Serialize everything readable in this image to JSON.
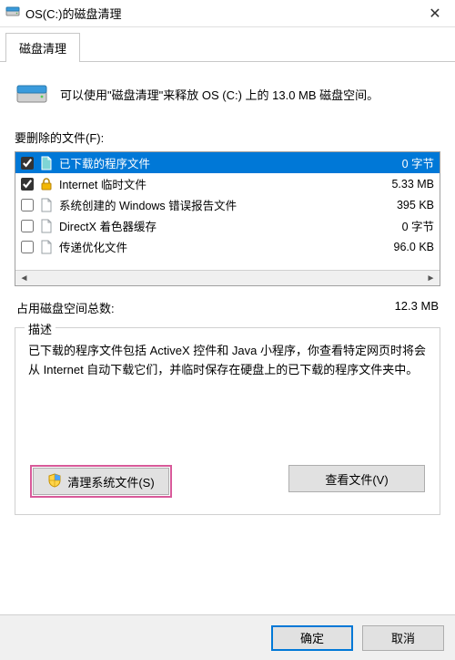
{
  "window": {
    "title": "OS(C:)的磁盘清理",
    "close_glyph": "✕"
  },
  "tab": {
    "label": "磁盘清理"
  },
  "intro": {
    "text": "可以使用\"磁盘清理\"来释放 OS (C:) 上的 13.0 MB 磁盘空间。"
  },
  "files_label": "要删除的文件(F):",
  "items": [
    {
      "checked": true,
      "selected": true,
      "icon": "file",
      "name": "已下载的程序文件",
      "size": "0 字节"
    },
    {
      "checked": true,
      "selected": false,
      "icon": "lock",
      "name": "Internet 临时文件",
      "size": "5.33 MB"
    },
    {
      "checked": false,
      "selected": false,
      "icon": "file",
      "name": "系统创建的 Windows 错误报告文件",
      "size": "395 KB"
    },
    {
      "checked": false,
      "selected": false,
      "icon": "file",
      "name": "DirectX 着色器缓存",
      "size": "0 字节"
    },
    {
      "checked": false,
      "selected": false,
      "icon": "file",
      "name": "传递优化文件",
      "size": "96.0 KB"
    }
  ],
  "scroll": {
    "left": "◄",
    "right": "►"
  },
  "totals": {
    "label": "占用磁盘空间总数:",
    "value": "12.3 MB"
  },
  "description": {
    "legend": "描述",
    "text": "已下载的程序文件包括 ActiveX 控件和 Java 小程序，你查看特定网页时将会从 Internet 自动下载它们，并临时保存在硬盘上的已下载的程序文件夹中。"
  },
  "buttons": {
    "clean_system": "清理系统文件(S)",
    "view_files": "查看文件(V)",
    "ok": "确定",
    "cancel": "取消"
  }
}
